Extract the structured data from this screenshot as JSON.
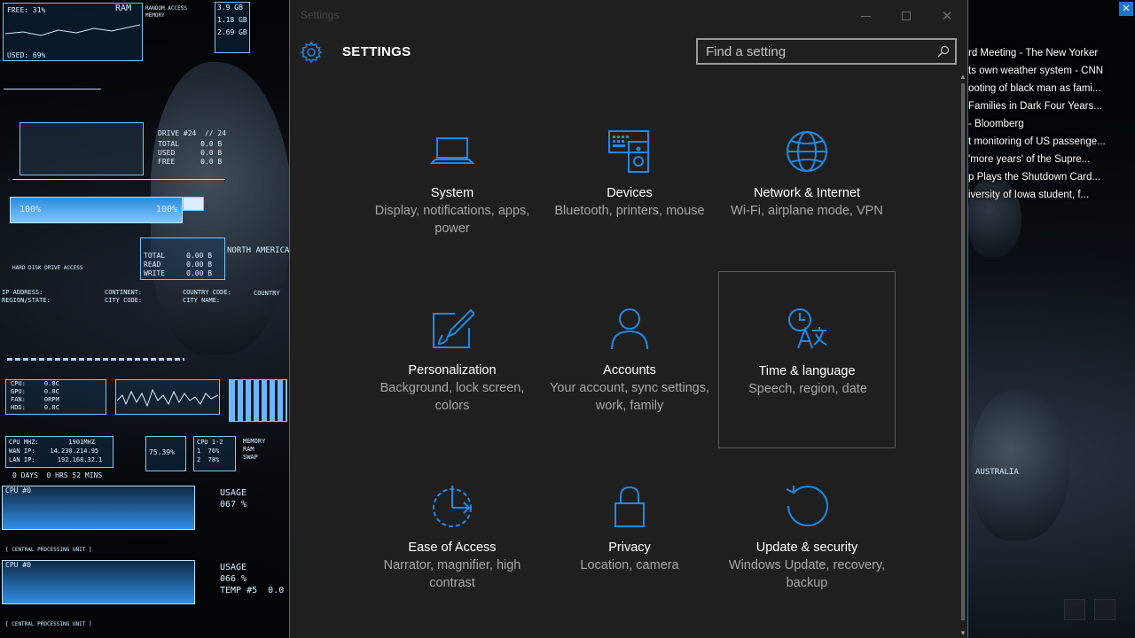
{
  "window": {
    "title": "Settings",
    "heading": "SETTINGS",
    "controls": {
      "minimize": "—",
      "maximize": "□",
      "close": "✕"
    }
  },
  "search": {
    "placeholder": "Find a setting",
    "value": "",
    "icon": "search-icon"
  },
  "tiles": [
    {
      "name": "System",
      "description": "Display, notifications, apps, power",
      "icon": "laptop-icon",
      "selected": false
    },
    {
      "name": "Devices",
      "description": "Bluetooth, printers, mouse",
      "icon": "devices-icon",
      "selected": false
    },
    {
      "name": "Network & Internet",
      "description": "Wi-Fi, airplane mode, VPN",
      "icon": "globe-icon",
      "selected": false
    },
    {
      "name": "Personalization",
      "description": "Background, lock screen, colors",
      "icon": "paintbrush-icon",
      "selected": false
    },
    {
      "name": "Accounts",
      "description": "Your account, sync settings, work, family",
      "icon": "person-icon",
      "selected": false
    },
    {
      "name": "Time & language",
      "description": "Speech, region, date",
      "icon": "clock-language-icon",
      "selected": true
    },
    {
      "name": "Ease of Access",
      "description": "Narrator, magnifier, high contrast",
      "icon": "ease-of-access-icon",
      "selected": false
    },
    {
      "name": "Privacy",
      "description": "Location, camera",
      "icon": "lock-icon",
      "selected": false
    },
    {
      "name": "Update & security",
      "description": "Windows Update, recovery, backup",
      "icon": "refresh-icon",
      "selected": false
    }
  ],
  "news": {
    "items": [
      "rd Meeting - The New Yorker",
      "ts own weather system - CNN",
      "ooting of black man as fami...",
      "Families in Dark Four Years...",
      "- Bloomberg",
      "t monitoring of US passenge...",
      "'more years' of the Supre...",
      "p Plays the Shutdown Card...",
      "iversity of Iowa student, f..."
    ]
  },
  "hud": {
    "free": "FREE: 31%",
    "used": "USED: 69%",
    "ram": "RAM",
    "ram_caption": "RANDOM ACCESS\nMEMORY",
    "ram_values": [
      "3.9 GB",
      "1.18 GB",
      "2.69 GB"
    ],
    "drive": "DRIVE #24  // 24",
    "drive_rows": "TOTAL     0.0 B\nUSED      0.0 B\nFREE      0.0 B",
    "progress": "100%",
    "progress_right": "100%",
    "hdd_rows": "TOTAL     0.00 B\nREAD      0.00 B\nWRITE     0.00 B",
    "hdd_caption": "HARD DISK DRIVE ACCESS",
    "north_america": "NORTH AMERICA",
    "ip_labels": "IP ADDRESS:\nREGION/STATE:",
    "continent": "CONTINENT:\nCITY CODE:",
    "country_code": "COUNTRY CODE:\nCITY NAME:",
    "country": "COUNTRY",
    "temps": "CPU:     0.0C\nGPU:     0.0C\nFAN:     0RPM\nHDD:     0.0C",
    "net": "CPU MHZ:        1901MHZ\nWAN IP:    14.230.214.95\nLAN IP:      192.168.32.1",
    "uptime": "0 DAYS  0 HRS 52 MINS",
    "cpu_label": "CPU #0",
    "cpu_pct": "75.39%",
    "cpu_cores": "CPU 1-2\n1  76%\n2  78%",
    "memory": "MEMORY\nRAM\nSWAP",
    "usage1": "USAGE\n067 %",
    "usage2": "USAGE\n066 %\nTEMP #5  0.0",
    "cpu_caption": "[ CENTRAL PROCESSING UNIT ]",
    "australia": "AUSTRALIA"
  }
}
